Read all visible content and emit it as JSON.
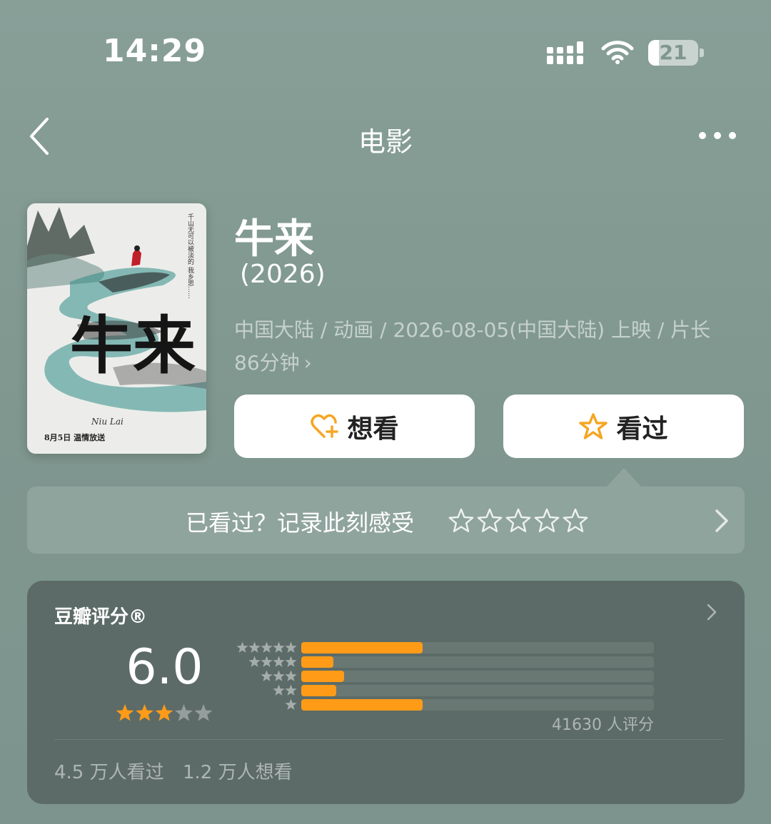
{
  "status_bar": {
    "time": "14:29",
    "battery_level": "21",
    "battery_fraction": 0.21,
    "icons": [
      "signal-icon",
      "wifi-icon",
      "battery-icon"
    ]
  },
  "nav": {
    "title": "电影",
    "back_icon": "chevron-left-icon",
    "more_icon": "more-dots-icon"
  },
  "poster": {
    "vertical_text": "千山无可以被淡的 我乡思……",
    "title_calligraphy": "牛来",
    "title_latin": "Niu Lai",
    "release_note": "8月5日 温情放送"
  },
  "movie": {
    "title": "牛来",
    "year": " (2026)",
    "meta": "中国大陆 / 动画 / 2026-08-05(中国大陆) 上映 / 片长86分钟",
    "meta_chevron": "›"
  },
  "actions": {
    "want_label": "想看",
    "want_icon": "heart-plus-icon",
    "seen_label": "看过",
    "seen_icon": "star-outline-icon"
  },
  "record": {
    "prompt": "已看过？记录此刻感受",
    "stars": 5
  },
  "rating": {
    "header": "豆瓣评分®",
    "score": "6.0",
    "score_stars": 3,
    "distribution": [
      {
        "stars": 5,
        "fraction": 0.344
      },
      {
        "stars": 4,
        "fraction": 0.091
      },
      {
        "stars": 3,
        "fraction": 0.121
      },
      {
        "stars": 2,
        "fraction": 0.099
      },
      {
        "stars": 1,
        "fraction": 0.345
      }
    ],
    "count": "41630 人评分",
    "seen_count": "4.5 万人看过",
    "want_count": "1.2 万人想看"
  },
  "colors": {
    "accent_orange": "#ff9b17",
    "background": "#849b94",
    "card": "#5c6b67"
  }
}
